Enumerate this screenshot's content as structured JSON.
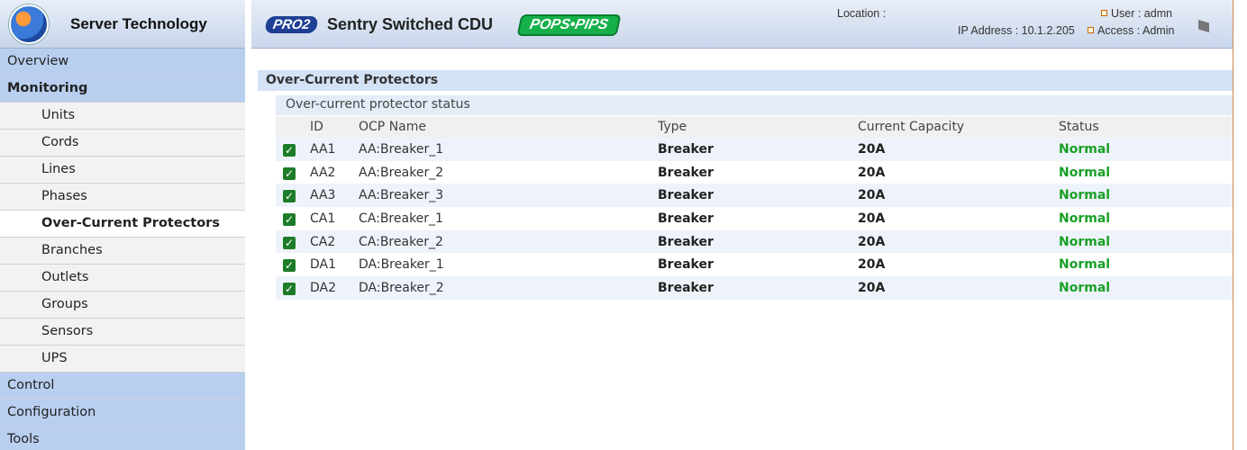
{
  "brand": {
    "name": "Server Technology",
    "logo_icon": "globe-logo-icon"
  },
  "header": {
    "pro_badge": "PRO2",
    "product": "Sentry Switched CDU",
    "pops_badge": "POPS•PIPS",
    "location_label": "Location :",
    "ip_address": "IP Address : 10.1.2.205",
    "user": "User : admn",
    "access": "Access : Admin"
  },
  "sidebar": {
    "overview": "Overview",
    "monitoring": "Monitoring",
    "monitoring_items": [
      "Units",
      "Cords",
      "Lines",
      "Phases",
      "Over-Current Protectors",
      "Branches",
      "Outlets",
      "Groups",
      "Sensors",
      "UPS"
    ],
    "control": "Control",
    "configuration": "Configuration",
    "tools": "Tools"
  },
  "main": {
    "section_title": "Over-Current Protectors",
    "subsection_title": "Over-current protector status",
    "columns": [
      "ID",
      "OCP Name",
      "Type",
      "Current Capacity",
      "Status"
    ],
    "rows": [
      {
        "id": "AA1",
        "name": "AA:Breaker_1",
        "type": "Breaker",
        "capacity": "20A",
        "status": "Normal"
      },
      {
        "id": "AA2",
        "name": "AA:Breaker_2",
        "type": "Breaker",
        "capacity": "20A",
        "status": "Normal"
      },
      {
        "id": "AA3",
        "name": "AA:Breaker_3",
        "type": "Breaker",
        "capacity": "20A",
        "status": "Normal"
      },
      {
        "id": "CA1",
        "name": "CA:Breaker_1",
        "type": "Breaker",
        "capacity": "20A",
        "status": "Normal"
      },
      {
        "id": "CA2",
        "name": "CA:Breaker_2",
        "type": "Breaker",
        "capacity": "20A",
        "status": "Normal"
      },
      {
        "id": "DA1",
        "name": "DA:Breaker_1",
        "type": "Breaker",
        "capacity": "20A",
        "status": "Normal"
      },
      {
        "id": "DA2",
        "name": "DA:Breaker_2",
        "type": "Breaker",
        "capacity": "20A",
        "status": "Normal"
      }
    ]
  },
  "colors": {
    "status_normal": "#18a026",
    "nav_top": "#b9cff0",
    "accent_border": "#d3874a"
  }
}
